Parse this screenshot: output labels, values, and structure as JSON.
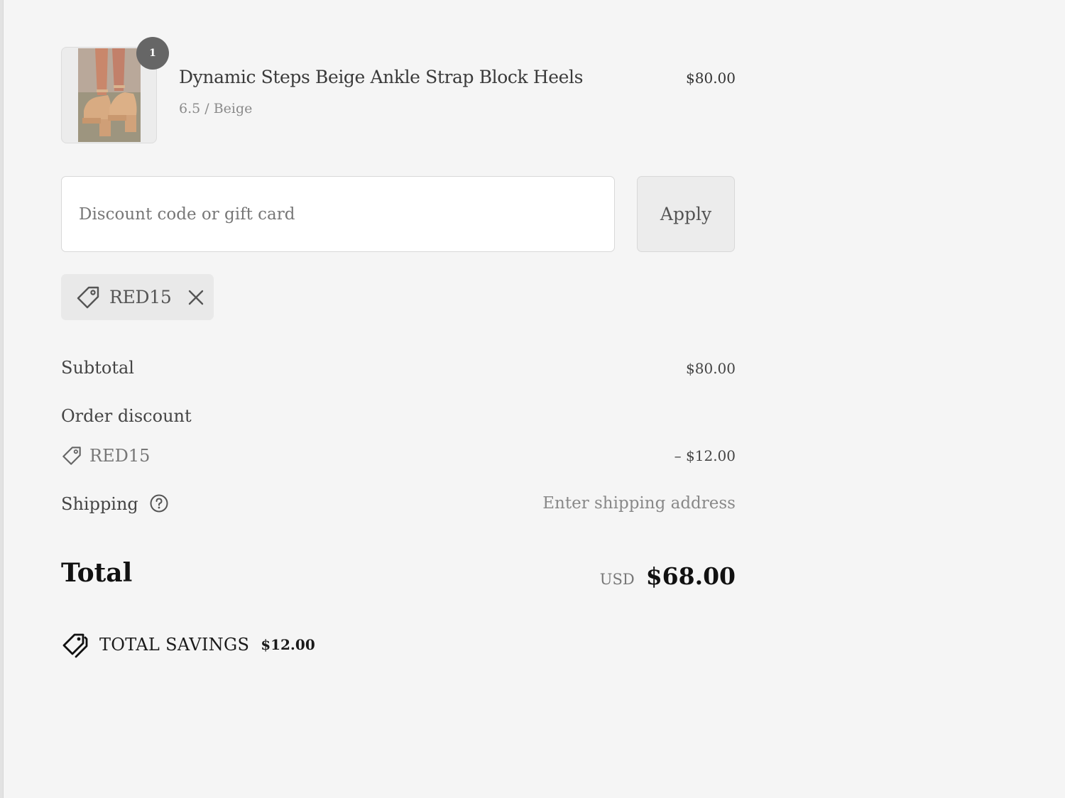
{
  "product": {
    "quantity": "1",
    "name": "Dynamic Steps Beige Ankle Strap Block Heels",
    "variant": "6.5 / Beige",
    "price": "$80.00",
    "image_icon": "beige-block-heels-photo"
  },
  "discount": {
    "placeholder": "Discount code or gift card",
    "apply_label": "Apply"
  },
  "applied_code": {
    "code": "RED15",
    "icon": "tag-icon",
    "remove_icon": "close-icon"
  },
  "totals": {
    "subtotal_label": "Subtotal",
    "subtotal_value": "$80.00",
    "order_discount_label": "Order discount",
    "discount_code": "RED15",
    "discount_value": "– $12.00",
    "shipping_label": "Shipping",
    "shipping_value": "Enter shipping address",
    "total_label": "Total",
    "currency": "USD",
    "total_value": "$68.00"
  },
  "savings": {
    "label": "TOTAL SAVINGS",
    "amount": "$12.00",
    "icon": "double-tag-icon"
  },
  "colors": {
    "background": "#f5f5f5",
    "badge": "#666666",
    "chip": "#e9e9e9"
  }
}
